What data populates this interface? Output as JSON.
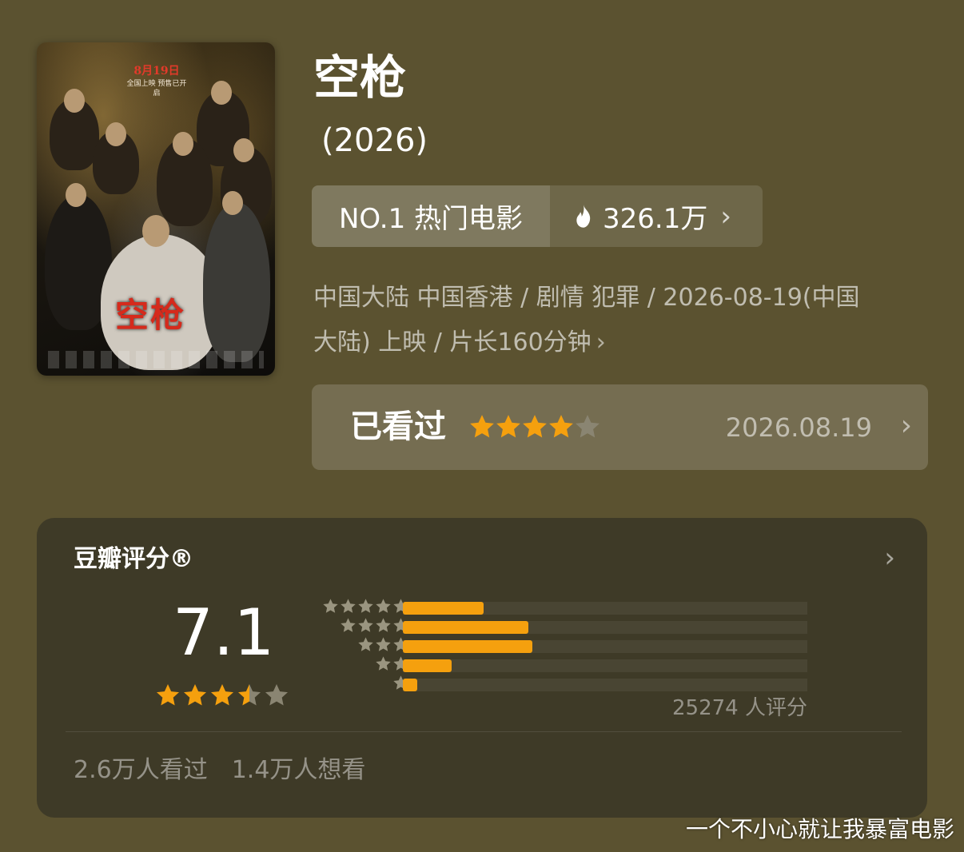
{
  "movie": {
    "title": "空枪",
    "year": "(2026)",
    "poster": {
      "date": "8月19日",
      "date_sub": "全国上映 预售已开启",
      "title_text": "空枪"
    }
  },
  "rank": {
    "label": "NO.1 热门电影",
    "heat": "326.1万",
    "icon": "flame-icon"
  },
  "meta": {
    "line1": "中国大陆 中国香港 / 剧情 犯罪 / 2026-08-19(中国",
    "line2": "大陆) 上映 / 片长160分钟"
  },
  "watched": {
    "label": "已看过",
    "user_rating_stars": 4,
    "max_stars": 5,
    "date": "2026.08.19"
  },
  "rating": {
    "heading": "豆瓣评分®",
    "score": "7.1",
    "score_stars": 3.5,
    "distribution": [
      {
        "stars": 5,
        "fraction": 0.2
      },
      {
        "stars": 4,
        "fraction": 0.31
      },
      {
        "stars": 3,
        "fraction": 0.32
      },
      {
        "stars": 2,
        "fraction": 0.12
      },
      {
        "stars": 1,
        "fraction": 0.035
      }
    ],
    "count_text": "25274 人评分",
    "watched_text": "2.6万人看过",
    "want_text": "1.4万人想看"
  },
  "colors": {
    "background": "#5b5230",
    "accent_orange": "#f5a00e",
    "star_gray": "#8a8572",
    "poster_title_red": "#d52a1c"
  },
  "watermark": "一个不小心就让我暴富电影"
}
